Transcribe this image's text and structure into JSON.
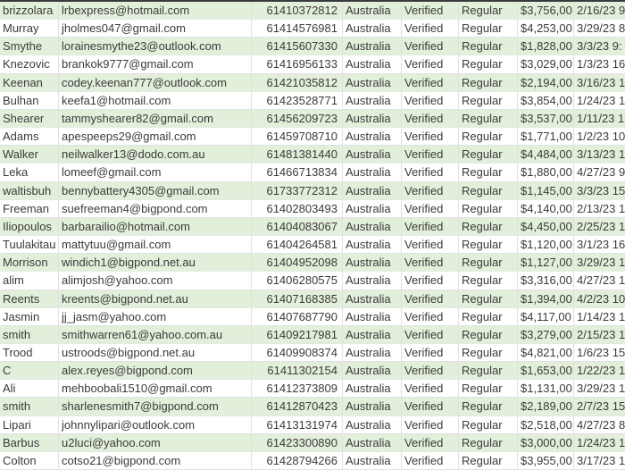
{
  "colors": {
    "band": "#e2efda",
    "text": "#3b3b3b"
  },
  "rows": [
    [
      "brizzolara",
      "lrbexpress@hotmail.com",
      "61410372812",
      "Australia",
      "Verified",
      "Regular",
      "$3,756,00",
      "2/16/23 9"
    ],
    [
      "Murray",
      "jholmes047@gmail.com",
      "61414576981",
      "Australia",
      "Verified",
      "Regular",
      "$4,253,00",
      "3/29/23 8"
    ],
    [
      "Smythe",
      "lorainesmythe23@outlook.com",
      "61415607330",
      "Australia",
      "Verified",
      "Regular",
      "$1,828,00",
      "3/3/23 9:"
    ],
    [
      "Knezovic",
      "brankok9777@gmail.com",
      "61416956133",
      "Australia",
      "Verified",
      "Regular",
      "$3,029,00",
      "1/3/23 16"
    ],
    [
      "Keenan",
      "codey.keenan777@outlook.com",
      "61421035812",
      "Australia",
      "Verified",
      "Regular",
      "$2,194,00",
      "3/16/23 1"
    ],
    [
      "Bulhan",
      "keefa1@hotmail.com",
      "61423528771",
      "Australia",
      "Verified",
      "Regular",
      "$3,854,00",
      "1/24/23 1"
    ],
    [
      "Shearer",
      "tammyshearer82@gmail.com",
      "61456209723",
      "Australia",
      "Verified",
      "Regular",
      "$3,537,00",
      "1/11/23 1"
    ],
    [
      "Adams",
      "apespeeps29@gmail.com",
      "61459708710",
      "Australia",
      "Verified",
      "Regular",
      "$1,771,00",
      "1/2/23 10"
    ],
    [
      "Walker",
      "neilwalker13@dodo.com.au",
      "61481381440",
      "Australia",
      "Verified",
      "Regular",
      "$4,484,00",
      "3/13/23 1"
    ],
    [
      "Leka",
      "lomeef@gmail.com",
      "61466713834",
      "Australia",
      "Verified",
      "Regular",
      "$1,880,00",
      "4/27/23 9"
    ],
    [
      "waltisbuh",
      "bennybattery4305@gmail.com",
      "61733772312",
      "Australia",
      "Verified",
      "Regular",
      "$1,145,00",
      "3/3/23 15"
    ],
    [
      "Freeman",
      "suefreeman4@bigpond.com",
      "61402803493",
      "Australia",
      "Verified",
      "Regular",
      "$4,140,00",
      "2/13/23 1"
    ],
    [
      "Iliopoulos",
      "barbarailio@hotmail.com",
      "61404083067",
      "Australia",
      "Verified",
      "Regular",
      "$4,450,00",
      "2/25/23 1"
    ],
    [
      "Tuulakitau",
      "mattytuu@gmail.com",
      "61404264581",
      "Australia",
      "Verified",
      "Regular",
      "$1,120,00",
      "3/1/23 16"
    ],
    [
      "Morrison",
      "windich1@bigpond.net.au",
      "61404952098",
      "Australia",
      "Verified",
      "Regular",
      "$1,127,00",
      "3/29/23 1"
    ],
    [
      "alim",
      "alimjosh@yahoo.com",
      "61406280575",
      "Australia",
      "Verified",
      "Regular",
      "$3,316,00",
      "4/27/23 1"
    ],
    [
      "Reents",
      "kreents@bigpond.net.au",
      "61407168385",
      "Australia",
      "Verified",
      "Regular",
      "$1,394,00",
      "4/2/23 10"
    ],
    [
      "Jasmin",
      "jj_jasm@yahoo.com",
      "61407687790",
      "Australia",
      "Verified",
      "Regular",
      "$4,117,00",
      "1/14/23 1"
    ],
    [
      "smith",
      "smithwarren61@yahoo.com.au",
      "61409217981",
      "Australia",
      "Verified",
      "Regular",
      "$3,279,00",
      "2/15/23 1"
    ],
    [
      "Trood",
      "ustroods@bigpond.net.au",
      "61409908374",
      "Australia",
      "Verified",
      "Regular",
      "$4,821,00",
      "1/6/23 15"
    ],
    [
      "C",
      "alex.reyes@bigpond.com",
      "61411302154",
      "Australia",
      "Verified",
      "Regular",
      "$1,653,00",
      "1/22/23 1"
    ],
    [
      "Ali",
      "mehboobali1510@gmail.com",
      "61412373809",
      "Australia",
      "Verified",
      "Regular",
      "$1,131,00",
      "3/29/23 1"
    ],
    [
      "smith",
      "sharlenesmith7@bigpond.com",
      "61412870423",
      "Australia",
      "Verified",
      "Regular",
      "$2,189,00",
      "2/7/23 15"
    ],
    [
      "Lipari",
      "johnnylipari@outlook.com",
      "61413131974",
      "Australia",
      "Verified",
      "Regular",
      "$2,518,00",
      "4/27/23 8"
    ],
    [
      "Barbus",
      "u2luci@yahoo.com",
      "61423300890",
      "Australia",
      "Verified",
      "Regular",
      "$3,000,00",
      "1/24/23 1"
    ],
    [
      "Colton",
      "cotso21@bigpond.com",
      "61428794266",
      "Australia",
      "Verified",
      "Regular",
      "$3,955,00",
      "3/17/23 1"
    ]
  ]
}
